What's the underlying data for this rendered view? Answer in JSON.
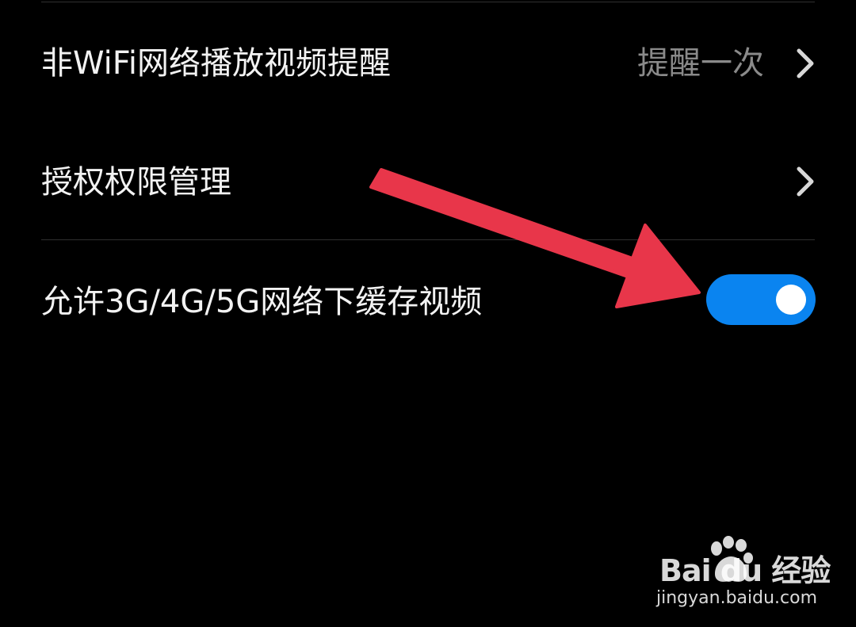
{
  "settings": {
    "items": [
      {
        "label": "非WiFi网络播放视频提醒",
        "value": "提醒一次"
      },
      {
        "label": "授权权限管理"
      },
      {
        "label": "允许3G/4G/5G网络下缓存视频",
        "toggle_on": true
      }
    ]
  },
  "colors": {
    "background": "#000000",
    "toggle_on": "#0a84f0",
    "arrow": "#e8364a",
    "value_text": "#8a8a8a"
  },
  "icons": {
    "chevron": "chevron-right-icon",
    "annotation": "red-arrow-icon",
    "watermark_logo": "baidu-paw-icon"
  },
  "watermark": {
    "brand": "Bai du 经验",
    "url": "jingyan.baidu.com"
  }
}
